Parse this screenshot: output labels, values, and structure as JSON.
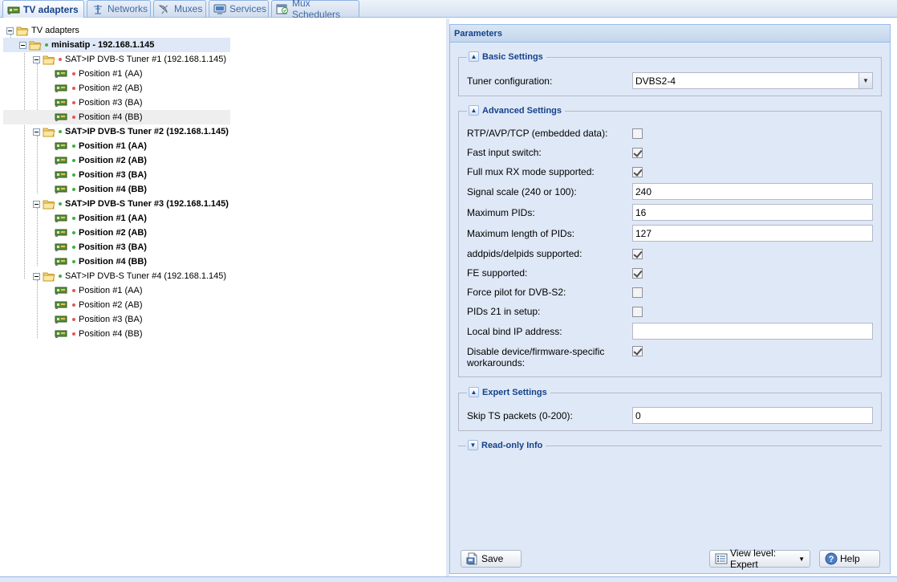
{
  "tabs": [
    {
      "label": "TV adapters",
      "icon": "tv-card-icon",
      "active": true
    },
    {
      "label": "Networks",
      "icon": "antenna-icon"
    },
    {
      "label": "Muxes",
      "icon": "satellite-dish-icon"
    },
    {
      "label": "Services",
      "icon": "tv-screen-icon"
    },
    {
      "label": "Mux Schedulers",
      "icon": "calendar-icon"
    }
  ],
  "tree": {
    "root": "TV adapters",
    "adapter": "minisatip - 192.168.1.145",
    "tuners": [
      {
        "label": "SAT>IP DVB-S Tuner #1 (192.168.1.145)",
        "status": "red",
        "bold": false,
        "positions": [
          "Position #1 (AA)",
          "Position #2 (AB)",
          "Position #3 (BA)",
          "Position #4 (BB)"
        ]
      },
      {
        "label": "SAT>IP DVB-S Tuner #2 (192.168.1.145)",
        "status": "green",
        "bold": true,
        "positions": [
          "Position #1 (AA)",
          "Position #2 (AB)",
          "Position #3 (BA)",
          "Position #4 (BB)"
        ]
      },
      {
        "label": "SAT>IP DVB-S Tuner #3 (192.168.1.145)",
        "status": "green",
        "bold": true,
        "positions": [
          "Position #1 (AA)",
          "Position #2 (AB)",
          "Position #3 (BA)",
          "Position #4 (BB)"
        ]
      },
      {
        "label": "SAT>IP DVB-S Tuner #4 (192.168.1.145)",
        "status": "green",
        "bold": false,
        "positions": [
          "Position #1 (AA)",
          "Position #2 (AB)",
          "Position #3 (BA)",
          "Position #4 (BB)"
        ]
      }
    ]
  },
  "panel": {
    "title": "Parameters",
    "basic": {
      "legend": "Basic Settings",
      "tuner_config_label": "Tuner configuration:",
      "tuner_config_value": "DVBS2-4"
    },
    "advanced": {
      "legend": "Advanced Settings",
      "rtp_label": "RTP/AVP/TCP (embedded data):",
      "rtp_checked": false,
      "fast_switch_label": "Fast input switch:",
      "fast_switch_checked": true,
      "full_mux_label": "Full mux RX mode supported:",
      "full_mux_checked": true,
      "signal_scale_label": "Signal scale (240 or 100):",
      "signal_scale_value": "240",
      "max_pids_label": "Maximum PIDs:",
      "max_pids_value": "16",
      "max_pids_len_label": "Maximum length of PIDs:",
      "max_pids_len_value": "127",
      "addpids_label": "addpids/delpids supported:",
      "addpids_checked": true,
      "fe_label": "FE supported:",
      "fe_checked": true,
      "force_pilot_label": "Force pilot for DVB-S2:",
      "force_pilot_checked": false,
      "pids21_label": "PIDs 21 in setup:",
      "pids21_checked": false,
      "local_bind_label": "Local bind IP address:",
      "local_bind_value": "",
      "disable_workarounds_label": "Disable device/firmware-specific workarounds:",
      "disable_workarounds_checked": true
    },
    "expert": {
      "legend": "Expert Settings",
      "skip_ts_label": "Skip TS packets (0-200):",
      "skip_ts_value": "0"
    },
    "readonly": {
      "legend": "Read-only Info"
    },
    "buttons": {
      "save": "Save",
      "view_level": "View level: Expert",
      "help": "Help"
    }
  },
  "colors": {
    "panel_bg": "#dfe8f6",
    "header_text": "#15428b",
    "status_green": "#3cb043",
    "status_red": "#e0585a"
  }
}
